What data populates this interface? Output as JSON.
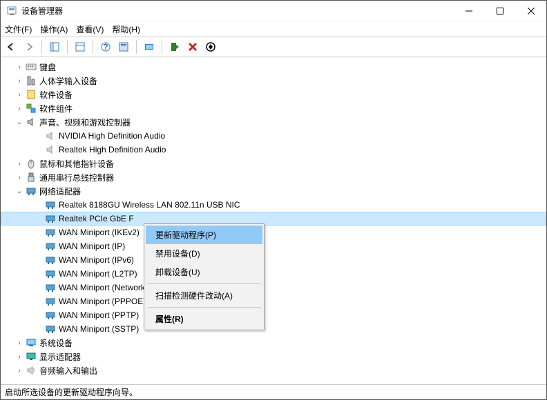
{
  "window": {
    "title": "设备管理器"
  },
  "menu": {
    "file": "文件(F)",
    "action": "操作(A)",
    "view": "查看(V)",
    "help": "帮助(H)"
  },
  "tree": {
    "keyboard": "键盘",
    "hid": "人体学输入设备",
    "software_devices": "软件设备",
    "software_components": "软件组件",
    "sound": "声音、视频和游戏控制器",
    "sound_children": [
      "NVIDIA High Definition Audio",
      "Realtek High Definition Audio"
    ],
    "mouse": "鼠标和其他指针设备",
    "usb": "通用串行总线控制器",
    "network": "网络适配器",
    "network_children": [
      "Realtek 8188GU Wireless LAN 802.11n USB NIC",
      "Realtek PCIe GbE Family Controller",
      "WAN Miniport (IKEv2)",
      "WAN Miniport (IP)",
      "WAN Miniport (IPv6)",
      "WAN Miniport (L2TP)",
      "WAN Miniport (Network Monitor)",
      "WAN Miniport (PPPOE)",
      "WAN Miniport (PPTP)",
      "WAN Miniport (SSTP)"
    ],
    "network_selected_label": "Realtek PCIe GbE F",
    "system": "系统设备",
    "display": "显示适配器",
    "audio_io": "音频输入和输出"
  },
  "context": {
    "update": "更新驱动程序(P)",
    "disable": "禁用设备(D)",
    "uninstall": "卸载设备(U)",
    "scan": "扫描检测硬件改动(A)",
    "properties": "属性(R)"
  },
  "statusbar": {
    "text": "启动所选设备的更新驱动程序向导。"
  }
}
